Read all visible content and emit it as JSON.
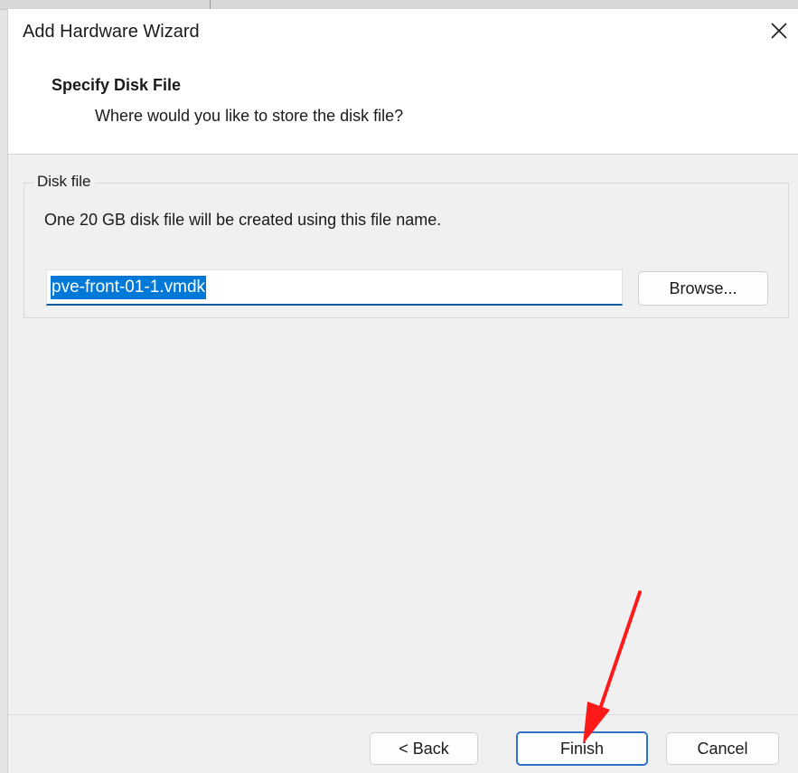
{
  "window": {
    "title": "Add Hardware Wizard",
    "close_icon": "close-icon"
  },
  "header": {
    "title": "Specify Disk File",
    "subtitle": "Where would you like to store the disk file?"
  },
  "disk_file": {
    "legend": "Disk file",
    "description": "One 20 GB disk file will be created using this file name.",
    "filename_value": "pve-front-01-1.vmdk",
    "browse_label": "Browse..."
  },
  "footer": {
    "back_label": "< Back",
    "finish_label": "Finish",
    "cancel_label": "Cancel"
  },
  "colors": {
    "selection": "#0078d7",
    "focus_border": "#2f73c7",
    "annotation_arrow": "#ff1a1a"
  }
}
